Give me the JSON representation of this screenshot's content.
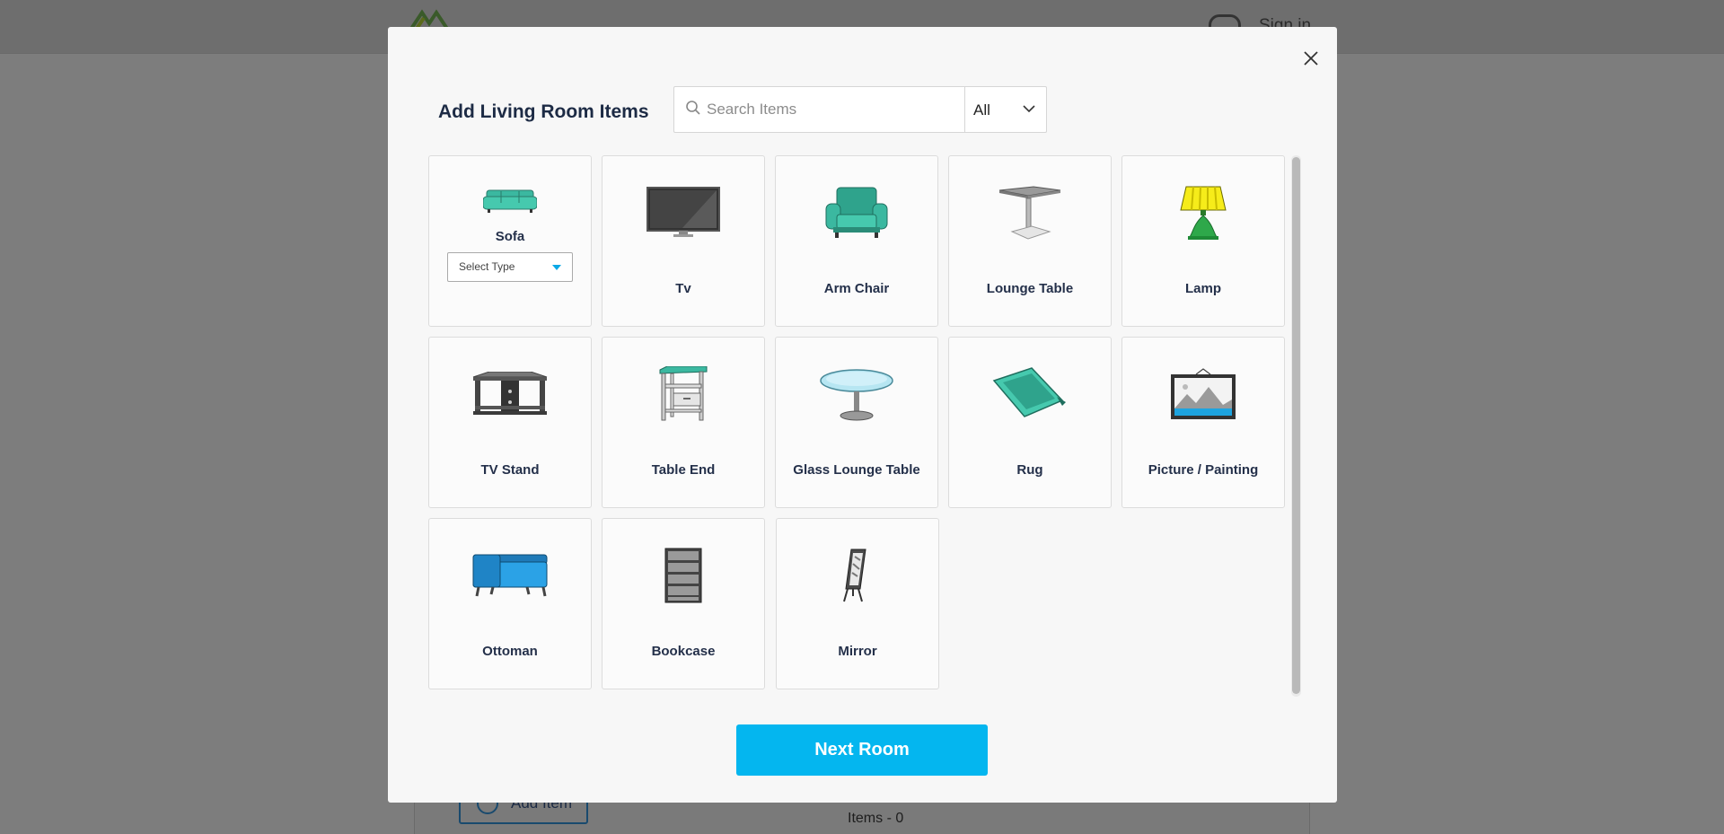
{
  "background": {
    "signin_label": "Sign in",
    "add_item_label": "Add Item",
    "items_count": "Items - 0"
  },
  "modal": {
    "title": "Add Living Room Items",
    "search": {
      "placeholder": "Search Items",
      "value": ""
    },
    "filter": {
      "selected": "All"
    },
    "next_button": "Next Room"
  },
  "items": [
    {
      "label": "Sofa",
      "icon": "sofa-icon",
      "type_select": "Select Type"
    },
    {
      "label": "Tv",
      "icon": "tv-icon"
    },
    {
      "label": "Arm Chair",
      "icon": "arm-chair-icon"
    },
    {
      "label": "Lounge Table",
      "icon": "lounge-table-icon"
    },
    {
      "label": "Lamp",
      "icon": "lamp-icon"
    },
    {
      "label": "TV Stand",
      "icon": "tv-stand-icon"
    },
    {
      "label": "Table End",
      "icon": "table-end-icon"
    },
    {
      "label": "Glass Lounge Table",
      "icon": "glass-lounge-table-icon"
    },
    {
      "label": "Rug",
      "icon": "rug-icon"
    },
    {
      "label": "Picture / Painting",
      "icon": "picture-painting-icon"
    },
    {
      "label": "Ottoman",
      "icon": "ottoman-icon"
    },
    {
      "label": "Bookcase",
      "icon": "bookcase-icon"
    },
    {
      "label": "Mirror",
      "icon": "mirror-icon"
    }
  ],
  "colors": {
    "accent": "#04b6ef",
    "teal": "#3bb8a0"
  }
}
